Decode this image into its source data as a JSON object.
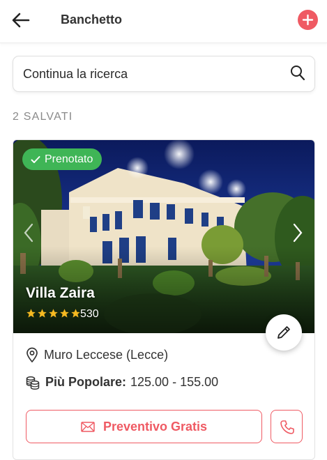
{
  "header": {
    "title": "Banchetto"
  },
  "search": {
    "text": "Continua la ricerca"
  },
  "saved": {
    "count_label": "2 SALVATI"
  },
  "card": {
    "badge": "Prenotato",
    "name": "Villa Zaira",
    "rating": 5,
    "reviews": "530",
    "location": "Muro Leccese (Lecce)",
    "price_label": "Più Popolare:",
    "price_value": "125.00 - 155.00",
    "quote_label": "Preventivo Gratis"
  },
  "colors": {
    "accent": "#ef5a63",
    "badge": "#3fb556",
    "star": "#f5b921"
  },
  "icons": [
    "back-arrow-icon",
    "plus-icon",
    "search-icon",
    "check-icon",
    "chevron-left-icon",
    "chevron-right-icon",
    "pencil-icon",
    "location-pin-icon",
    "coins-icon",
    "envelope-icon",
    "phone-icon"
  ]
}
